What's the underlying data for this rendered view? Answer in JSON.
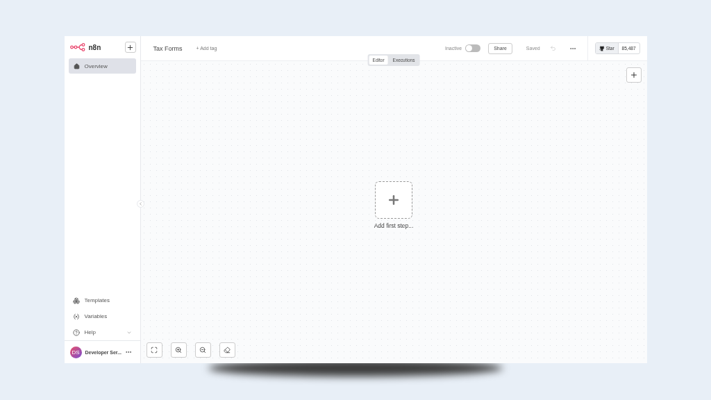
{
  "sidebar": {
    "brand": "n8n",
    "items": [
      {
        "label": "Overview",
        "selected": true
      }
    ],
    "bottom_items": [
      {
        "label": "Templates",
        "kind": "link"
      },
      {
        "label": "Variables",
        "kind": "link"
      },
      {
        "label": "Help",
        "kind": "menu"
      }
    ],
    "user": {
      "initials": "DS",
      "name": "Developer Ser..."
    }
  },
  "header": {
    "workflow_name": "Tax Forms",
    "add_tag": "+ Add tag",
    "active_label": "Inactive",
    "active": false,
    "share": "Share",
    "save_status": "Saved",
    "github": {
      "star": "Star",
      "count": "85,487"
    }
  },
  "view_tabs": [
    {
      "label": "Editor",
      "selected": true
    },
    {
      "label": "Executions",
      "selected": false
    }
  ],
  "canvas": {
    "add_first_step": "Add first step..."
  }
}
